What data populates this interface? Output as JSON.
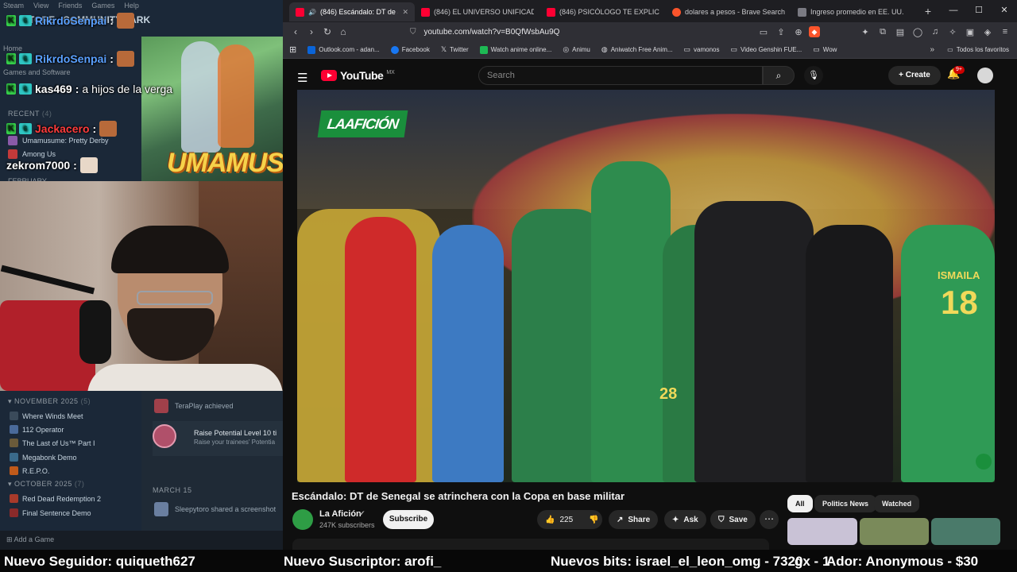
{
  "steam": {
    "menu": [
      "Steam",
      "View",
      "Friends",
      "Games",
      "Help"
    ],
    "nav": [
      "STORE",
      "COMMUNITY",
      "ARK"
    ],
    "home": "Home",
    "filter": "Games and Software",
    "recent_label": "RECENT",
    "recent_count": "(4)",
    "recent_games": [
      "Umamusume: Pretty Derby",
      "Among Us"
    ],
    "february_label": "FEBRUARY",
    "nov_label": "NOVEMBER 2025",
    "nov_count": "(5)",
    "nov_games": [
      "Where Winds Meet",
      "112 Operator",
      "The Last of Us™ Part I",
      "Megabonk Demo",
      "R.E.P.O."
    ],
    "oct_label": "OCTOBER 2025",
    "oct_count": "(7)",
    "oct_games": [
      "Red Dead Redemption 2",
      "Final Sentence Demo"
    ],
    "add_game": "Add a Game",
    "activity": {
      "user": "TeraPlay achieved",
      "ach_title": "Raise Potential Level 10 ti",
      "ach_desc": "Raise your trainees' Potentia",
      "date": "MARCH 15",
      "shared": "Sleepytoro shared a screenshot"
    }
  },
  "chat": [
    {
      "user": "RikrdoSenpai",
      "color": "#5aa0ff",
      "message": ""
    },
    {
      "user": "RikrdoSenpai",
      "color": "#5aa0ff",
      "message": ""
    },
    {
      "user": "kas469",
      "color": "#ffffff",
      "message": " a hijos de la verga"
    },
    {
      "user": "Jackacero",
      "color": "#ff3b3b",
      "message": ""
    },
    {
      "user": "zekrom7000",
      "color": "#ffffff",
      "message": ""
    }
  ],
  "art": {
    "logo_text": "UMAMUS"
  },
  "browser": {
    "tabs": [
      {
        "title": "(846) Escándalo: DT de Sen",
        "icon": "youtube-icon",
        "active": true
      },
      {
        "title": "(846) EL UNIVERSO UNIFICADO V",
        "icon": "youtube-icon",
        "active": false
      },
      {
        "title": "(846) PSICÓLOGO TE EXPLICA QUÉ",
        "icon": "youtube-icon",
        "active": false
      },
      {
        "title": "dolares a pesos - Brave Search",
        "icon": "brave-icon",
        "active": false
      },
      {
        "title": "Ingreso promedio en EE. UU.",
        "icon": "page-icon",
        "active": false
      }
    ],
    "url": "youtube.com/watch?v=B0QfWsbAu9Q",
    "bookmarks": [
      "Outlook.com - adan...",
      "Facebook",
      "Twitter",
      "Watch anime online...",
      "Animu",
      "Aniwatch Free Anim...",
      "vamonos",
      "Video Genshin FUE...",
      "Wow"
    ],
    "bookmark_colors": [
      "#0a64d8",
      "#1877f2",
      "#000000",
      "#1db954",
      "#8a8a8a",
      "#8a8a8a",
      "#c9a64a",
      "#c9a64a",
      "#c9a64a"
    ],
    "all_bookmarks": "Todos los favoritos"
  },
  "youtube": {
    "logo": "YouTube",
    "region": "MX",
    "search_placeholder": "Search",
    "create": "Create",
    "notifications": "9+",
    "video_title": "Escándalo: DT de Senegal se atrinchera con la Copa en base militar",
    "channel_name": "La Afición",
    "subscribers": "247K subscribers",
    "subscribe": "Subscribe",
    "likes": "225",
    "share": "Share",
    "ask": "Ask",
    "save": "Save",
    "player_logo": "LAAFICIÓN",
    "jersey_name": "ISMAILA",
    "jersey_number": "18",
    "jersey_number_2": "28",
    "chips": [
      "All",
      "Politics News",
      "Watched"
    ]
  },
  "ticker": {
    "follower": "Nuevo Seguidor: quiqueth627",
    "subscriber": "Nuevo Suscriptor: arofi_",
    "bits": "Nuevos bits: israel_el_leon_omg - 7320",
    "donor": "gx - 1",
    "donation": "Ador: Anonymous - $30"
  }
}
